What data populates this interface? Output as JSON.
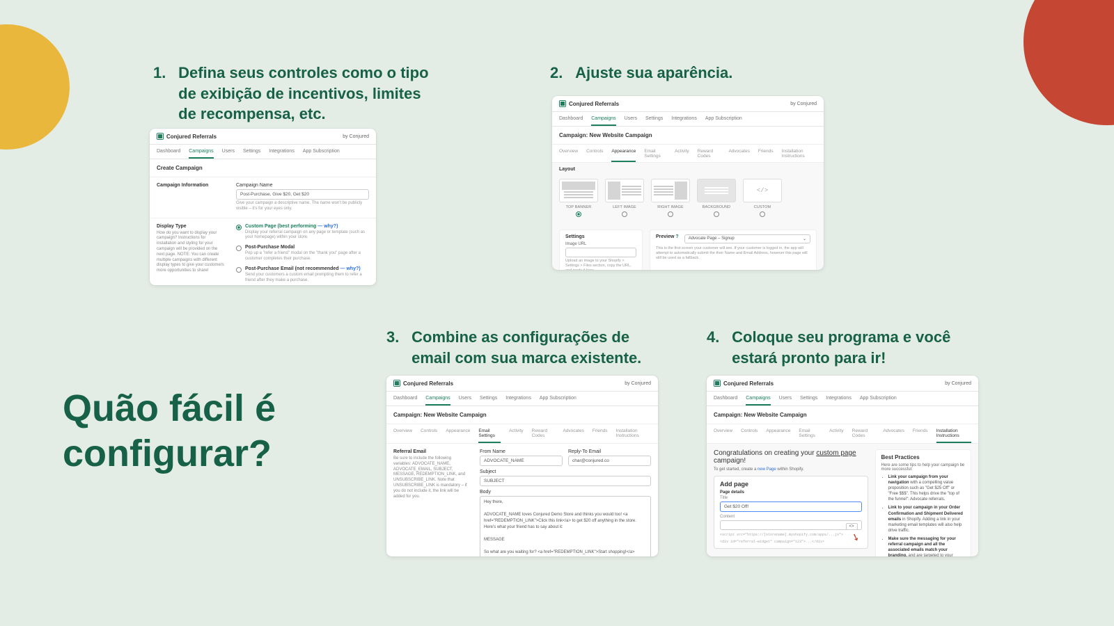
{
  "headline_l1": "Quão fácil é",
  "headline_l2": "configurar?",
  "steps": {
    "s1": {
      "num": "1.",
      "text_l1": "Defina seus controles como o tipo",
      "text_l2": "de exibição de incentivos, limites",
      "text_l3": "de recompensa, etc."
    },
    "s2": {
      "num": "2.",
      "text": "Ajuste sua aparência."
    },
    "s3": {
      "num": "3.",
      "text_l1": "Combine as configurações de",
      "text_l2": "email com sua marca existente."
    },
    "s4": {
      "num": "4.",
      "text_l1": "Coloque seu programa e você",
      "text_l2": "estará pronto para ir!"
    }
  },
  "app": {
    "name": "Conjured Referrals",
    "by": "by Conjured",
    "tabs": [
      "Dashboard",
      "Campaigns",
      "Users",
      "Settings",
      "Integrations",
      "App Subscription"
    ],
    "campaign_title": "Campaign: New Website Campaign",
    "subtabs": [
      "Overview",
      "Controls",
      "Appearance",
      "Email Settings",
      "Activity",
      "Reward Codes",
      "Advocates",
      "Friends",
      "Installation Instructions"
    ]
  },
  "shot1": {
    "section": "Create Campaign",
    "info_label": "Campaign Information",
    "name_label": "Campaign Name",
    "name_value": "Post-Purchase, Give $20, Get $20",
    "name_hint": "Give your campaign a descriptive name. The name won't be publicly visible – it's for your eyes only.",
    "display_label": "Display Type",
    "display_hint": "How do you want to display your campaign? Instructions for installation and styling for your campaign will be provided on the next page. NOTE: You can create multiple campaigns with different display types to give your customers more opportunities to share!",
    "opt1_label": "Custom Page (best performing",
    "opt1_why": "— why?)",
    "opt1_hint": "Display your referral campaign on any page or template (such as your homepage) within your store.",
    "opt2_label": "Post-Purchase Modal",
    "opt2_hint": "Pop up a \"refer a friend\" modal on the \"thank you\" page after a customer completes their purchase.",
    "opt3_label": "Post-Purchase Email (not recommended",
    "opt3_why": "— why?)",
    "opt3_hint": "Send your customers a custom email prompting them to refer a friend after they make a purchase."
  },
  "shot2": {
    "layout_label": "Layout",
    "layouts": [
      "TOP BANNER",
      "LEFT IMAGE",
      "RIGHT IMAGE",
      "BACKGROUND",
      "CUSTOM"
    ],
    "settings_label": "Settings",
    "image_url_label": "Image URL",
    "image_url_hint": "Upload an image to your Shopify > Settings > Files section, copy the URL, and paste it here.",
    "preview_label": "Preview",
    "preview_select": "Advocate Page – Signup",
    "preview_desc": "This is the first screen your customer will see. If your customer is logged in, the app will attempt to automatically submit the their Name and Email Address, however this page will still be used as a fallback."
  },
  "shot3": {
    "ref_label": "Referral Email",
    "ref_hint": "Be sure to include the following variables: ADVOCATE_NAME, ADVOCATE_EMAIL, SUBJECT, MESSAGE, REDEMPTION_LINK, and UNSUBSCRIBE_LINK. Note that UNSUBSCRIBE_LINK is mandatory – if you do not include it, the link will be added for you.",
    "from_label": "From Name",
    "from_val": "ADVOCATE_NAME",
    "reply_label": "Reply-To Email",
    "reply_val": "char@conjured.co",
    "subject_label": "Subject",
    "subject_val": "SUBJECT",
    "body_label": "Body",
    "body_l1": "Hey there,",
    "body_l2": "ADVOCATE_NAME loves Conjured Demo Store and thinks you would too! <a href=\"REDEMPTION_LINK\">Click this link</a> to get $20 off anything in the store. Here's what your friend has to say about it:",
    "body_l3": "MESSAGE",
    "body_l4": "So what are you waiting for? <a href=\"REDEMPTION_LINK\">Start shopping!</a>"
  },
  "shot4": {
    "congrats_a": "Congratulations on creating your ",
    "congrats_b": "custom page",
    "congrats_c": " campaign!",
    "start": "To get started, create a ",
    "start_link": "new Page",
    "start_b": " within Shopify.",
    "addpage": "Add page",
    "page_details": "Page details",
    "title_lbl": "Title",
    "title_val": "Get $20 Off!",
    "content_lbl": "Content",
    "btn": "<>",
    "mono1": "<script src=\"https://[storename].myshopify.com/apps/...js\">",
    "mono2": "<div id=\"referral-widget\" campaign=\"123\">...</div>",
    "bp_title": "Best Practices",
    "bp_intro": "Here are some tips to help your campaign be more successful:",
    "bp1": "Link your campaign from your navigation with a compelling value proposition such as \"Get $25 Off\" or \"Free $$$\". This helps drive the \"top of the funnel\": Advocate referrals.",
    "bp2": "Link to your campaign in your Order Confirmation and Shipment Delivered emails in Shopify. Adding a link in your marketing email templates will also help drive traffic.",
    "bp3": "Make sure the messaging for your referral campaign and all the associated emails match your branding, and are targeted to your customer base. The more personal your text and emails, the more likely you'll get"
  }
}
